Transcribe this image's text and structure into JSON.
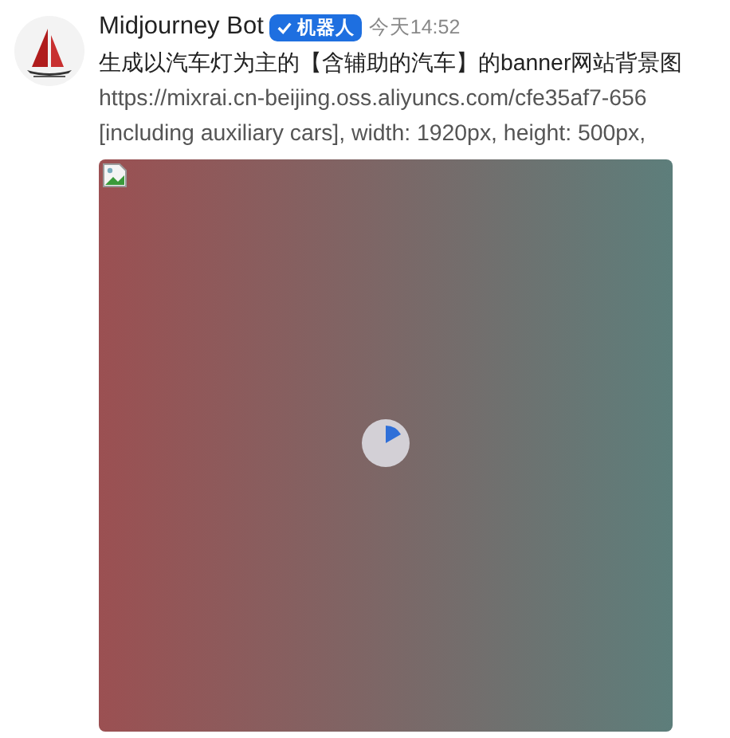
{
  "message": {
    "sender": "Midjourney Bot",
    "badge": "机器人",
    "time": "今天14:52",
    "lines": [
      "生成以汽车灯为主的【含辅助的汽车】的banner网站背景图",
      "https://mixrai.cn-beijing.oss.aliyuncs.com/cfe35af7-656",
      "[including auxiliary cars], width: 1920px, height: 500px,"
    ],
    "attachment": {
      "kind": "image"
    }
  }
}
